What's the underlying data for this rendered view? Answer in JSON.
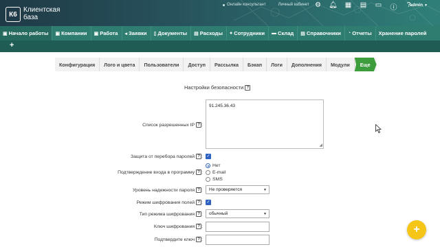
{
  "header": {
    "logo_mark": "К6",
    "logo_line1": "Клиентская",
    "logo_line2": "база",
    "link_online": "Онлайн консультант",
    "link_cabinet": "Личный кабинет",
    "user": "admin",
    "icons": [
      "gear-icon",
      "bell-icon",
      "grid-icon",
      "calendar-icon",
      "card-icon",
      "info-icon",
      "help-icon"
    ]
  },
  "nav": {
    "items": [
      {
        "label": "Начало работы",
        "icon": "home-icon"
      },
      {
        "label": "Компании",
        "icon": "companies-icon"
      },
      {
        "label": "Работа",
        "icon": "briefcase-icon"
      },
      {
        "label": "Заявки",
        "icon": "megaphone-icon"
      },
      {
        "label": "Документы",
        "icon": "document-icon"
      },
      {
        "label": "Расходы",
        "icon": "expenses-icon"
      },
      {
        "label": "Сотрудники",
        "icon": "people-icon"
      },
      {
        "label": "Склад",
        "icon": "truck-icon"
      },
      {
        "label": "Справочники",
        "icon": "book-icon"
      },
      {
        "label": "Отчеты",
        "icon": "chart-icon"
      },
      {
        "label": "Хранение паролей",
        "icon": ""
      }
    ],
    "add_label": "+"
  },
  "tabs": [
    "Конфигурация",
    "Лого и цвета",
    "Пользователи",
    "Доступ",
    "Рассылка",
    "Бэкап",
    "Логи",
    "Дополнения",
    "Модули",
    "Еще"
  ],
  "active_tab": "Еще",
  "form": {
    "title": "Настройки безопасности",
    "help": "?",
    "allowed_ip_label": "Список разрешенных IP",
    "allowed_ip_value": "91.245.36.43",
    "brute_force_label": "Защита от перебора паролей",
    "brute_force_checked": true,
    "login_confirm_label": "Подтверждение входа в программу",
    "login_confirm_options": [
      "Нет",
      "E-mail",
      "SMS"
    ],
    "login_confirm_selected": "Нет",
    "password_strength_label": "Уровень надежности пароля",
    "password_strength_value": "Не проверяется",
    "field_encryption_label": "Режим шифрования полей",
    "field_encryption_checked": true,
    "encryption_type_label": "Тип режима шифрования",
    "encryption_type_value": "обычный",
    "encryption_key_label": "Ключ шифрования",
    "encryption_key_value": "",
    "confirm_key_label": "Подтвердите ключ",
    "confirm_key_value": ""
  },
  "fab_label": "+"
}
